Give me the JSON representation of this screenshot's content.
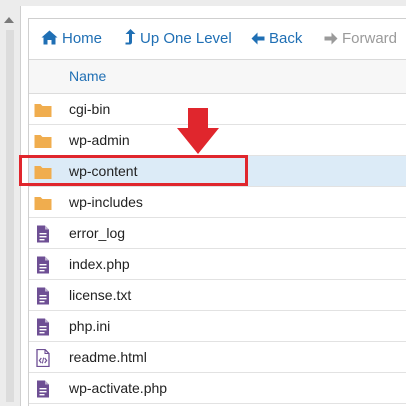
{
  "toolbar": {
    "home_label": "Home",
    "up_label": "Up One Level",
    "back_label": "Back",
    "forward_label": "Forward"
  },
  "table": {
    "column_name": "Name"
  },
  "files": [
    {
      "name": "cgi-bin",
      "type": "folder",
      "icon": "folder-icon"
    },
    {
      "name": "wp-admin",
      "type": "folder",
      "icon": "folder-icon"
    },
    {
      "name": "wp-content",
      "type": "folder",
      "icon": "folder-icon",
      "selected": true
    },
    {
      "name": "wp-includes",
      "type": "folder",
      "icon": "folder-icon"
    },
    {
      "name": "error_log",
      "type": "file",
      "icon": "text-file-icon"
    },
    {
      "name": "index.php",
      "type": "file",
      "icon": "text-file-icon"
    },
    {
      "name": "license.txt",
      "type": "file",
      "icon": "text-file-icon"
    },
    {
      "name": "php.ini",
      "type": "file",
      "icon": "text-file-icon"
    },
    {
      "name": "readme.html",
      "type": "file",
      "icon": "code-file-icon"
    },
    {
      "name": "wp-activate.php",
      "type": "file",
      "icon": "text-file-icon"
    }
  ],
  "colors": {
    "link_blue": "#1f6fb4",
    "folder": "#f0ad4e",
    "file_purple": "#6e4f94",
    "selection": "#dcebf7",
    "annotation_red": "#e0262d"
  }
}
